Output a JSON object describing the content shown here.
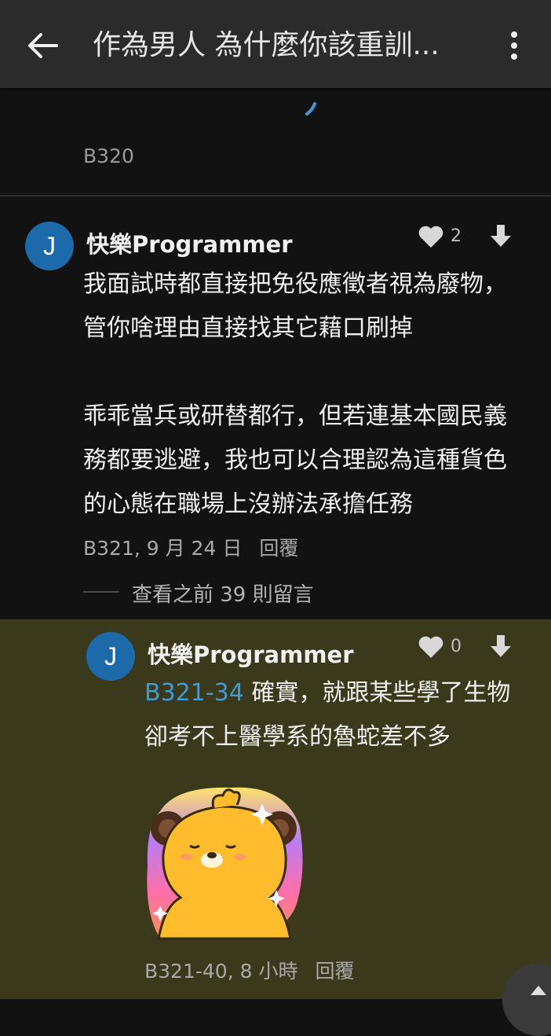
{
  "appbar": {
    "title": "作為男人 為什麼你該重訓..."
  },
  "previous_comment": {
    "floor": "B320"
  },
  "comment": {
    "avatar_letter": "J",
    "author": "快樂Programmer",
    "likes": "2",
    "text": "我面試時都直接把免役應徵者視為廢物，\n管你啥理由直接找其它藉口刷掉\n\n乖乖當兵或研替都行，但若連基本國民義\n務都要逃避，我也可以合理認為這種貨色\n的心態在職場上沒辦法承擔任務",
    "meta": "B321, 9 月 24 日",
    "reply_label": "回覆",
    "view_previous": "查看之前 39 則留言"
  },
  "reply": {
    "avatar_letter": "J",
    "author": "快樂Programmer",
    "likes": "0",
    "mention": "B321-34",
    "text_line1": " 確實，就跟某些學了生物",
    "text_line2": "卻考不上醫學系的魯蛇差不多",
    "meta": "B321-40, 8 小時",
    "reply_label": "回覆"
  },
  "colors": {
    "accent": "#3f9ad8",
    "avatar": "#1c6aa9",
    "highlight_bg": "#3a391c"
  }
}
